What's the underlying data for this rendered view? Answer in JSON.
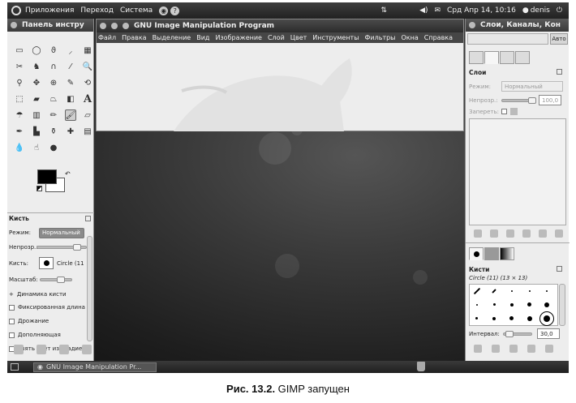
{
  "top_panel": {
    "menu": [
      "Приложения",
      "Переход",
      "Система"
    ],
    "clock": "Срд Апр 14, 10:16",
    "user": "denis"
  },
  "toolbox": {
    "title": "Панель инстру",
    "tool_options": {
      "heading": "Кисть",
      "mode_label": "Режим:",
      "mode_value": "Нормальный",
      "opacity_label": "Непрозр.:",
      "brush_label": "Кисть:",
      "brush_value": "Circle (11",
      "scale_label": "Масштаб:",
      "dynamics_label": "Динамика кисти",
      "checkboxes": [
        "Фиксированная длина",
        "Дрожание",
        "Дополняющая",
        "Взять цвет из градие"
      ]
    }
  },
  "image_window": {
    "title": "GNU Image Manipulation Program",
    "menu": [
      "Файл",
      "Правка",
      "Выделение",
      "Вид",
      "Изображение",
      "Слой",
      "Цвет",
      "Инструменты",
      "Фильтры",
      "Окна",
      "Справка"
    ]
  },
  "dock": {
    "title": "Слои, Каналы, Кон",
    "auto_button": "Авто",
    "layers": {
      "heading": "Слои",
      "mode_label": "Режим:",
      "mode_value": "Нормальный",
      "opacity_label": "Непрозр.:",
      "opacity_value": "100,0",
      "lock_label": "Запереть:"
    },
    "brushes": {
      "heading": "Кисти",
      "selected": "Circle (11) (13 × 13)",
      "spacing_label": "Интервал:",
      "spacing_value": "30,0"
    }
  },
  "taskbar": {
    "task": "GNU Image Manipulation Pr..."
  },
  "caption": {
    "label": "Рис. 13.2.",
    "text": " GIMP запущен"
  }
}
